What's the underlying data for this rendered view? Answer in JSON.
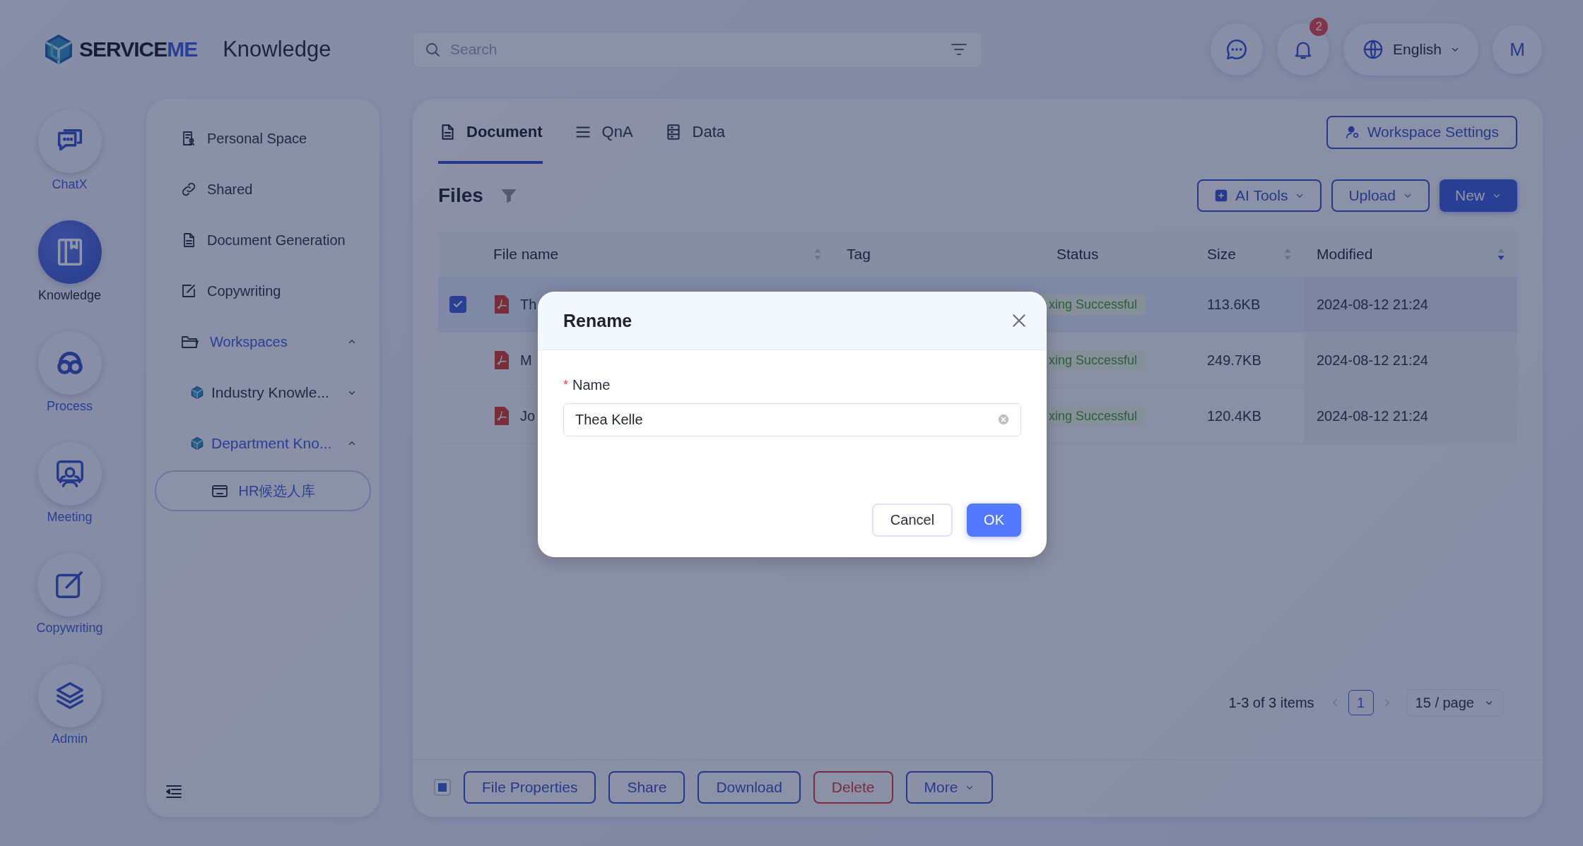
{
  "app": {
    "wordmark": [
      "SERVICE",
      "ME"
    ],
    "title": "Knowledge"
  },
  "search": {
    "placeholder": "Search"
  },
  "header": {
    "notifications_badge": "2",
    "language": "English",
    "avatar": "M"
  },
  "rail": [
    {
      "label": "ChatX",
      "selected": false
    },
    {
      "label": "Knowledge",
      "selected": true
    },
    {
      "label": "Process",
      "selected": false
    },
    {
      "label": "Meeting",
      "selected": false
    },
    {
      "label": "Copywriting",
      "selected": false
    },
    {
      "label": "Admin",
      "selected": false
    }
  ],
  "sidebar": {
    "items": [
      {
        "label": "Personal Space"
      },
      {
        "label": "Shared"
      },
      {
        "label": "Document Generation"
      },
      {
        "label": "Copywriting"
      }
    ],
    "workspaces": {
      "label": "Workspaces",
      "expanded": true,
      "children": [
        {
          "label": "Industry Knowle...",
          "expanded": false
        },
        {
          "label": "Department Kno...",
          "expanded": true,
          "children": [
            {
              "label": "HR候选人库",
              "selected": true
            }
          ]
        }
      ]
    }
  },
  "tabs": [
    {
      "label": "Document",
      "selected": true
    },
    {
      "label": "QnA",
      "selected": false
    },
    {
      "label": "Data",
      "selected": false
    }
  ],
  "workspace_settings": "Workspace Settings",
  "files": {
    "title": "Files",
    "actions": [
      {
        "label": "AI Tools",
        "kind": "outline"
      },
      {
        "label": "Upload",
        "kind": "outline"
      },
      {
        "label": "New",
        "kind": "primary"
      }
    ]
  },
  "table": {
    "columns": [
      {
        "label": "File name",
        "sortable": true,
        "sorted_descending": false
      },
      {
        "label": "Tag"
      },
      {
        "label": "Status"
      },
      {
        "label": "Size",
        "sortable": true,
        "sorted_descending": false
      },
      {
        "label": "Modified",
        "sortable": true,
        "sorted_descending": true
      }
    ],
    "rows": [
      {
        "file_name": "Th",
        "status": "xing Successful",
        "size": "113.6KB",
        "modified": "2024-08-12 21:24",
        "selected": true
      },
      {
        "file_name": "M",
        "status": "xing Successful",
        "size": "249.7KB",
        "modified": "2024-08-12 21:24",
        "selected": false
      },
      {
        "file_name": "Jo",
        "status": "xing Successful",
        "size": "120.4KB",
        "modified": "2024-08-12 21:24",
        "selected": false
      }
    ]
  },
  "pagination": {
    "summary": "1-3 of 3 items",
    "pages": [
      {
        "label": "1",
        "selected": true
      }
    ],
    "page_size": "15 / page"
  },
  "bulk": {
    "indeterminate": true,
    "buttons": [
      {
        "label": "File Properties",
        "kind": "default"
      },
      {
        "label": "Share",
        "kind": "default"
      },
      {
        "label": "Download",
        "kind": "default"
      },
      {
        "label": "Delete",
        "kind": "danger"
      },
      {
        "label": "More",
        "kind": "dropdown"
      }
    ]
  },
  "dialog": {
    "title": "Rename",
    "field": {
      "label": "Name",
      "required": true,
      "required_mark": "*",
      "value": "Thea Kelle"
    },
    "buttons": [
      {
        "label": "Cancel",
        "kind": "default"
      },
      {
        "label": "OK",
        "kind": "primary"
      }
    ]
  }
}
